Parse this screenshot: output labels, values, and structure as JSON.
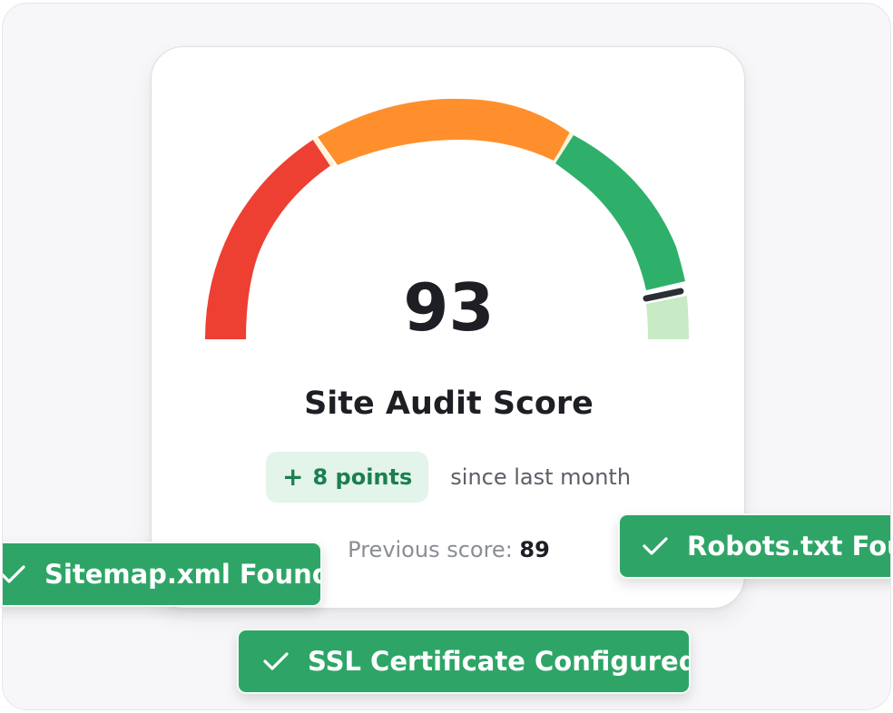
{
  "gauge": {
    "score": "93",
    "segment_colors": {
      "poor": "#ee3f33",
      "average": "#ff8f2c",
      "good": "#2fb06a",
      "remaining": "#c8eac4",
      "needle": "#2a2e35"
    }
  },
  "card": {
    "title": "Site Audit Score",
    "change_icon": "plus-icon",
    "change_label": "8 points",
    "change_suffix": "since last month",
    "previous_label": "Previous score: ",
    "previous_value": "89"
  },
  "badges": {
    "sitemap": "Sitemap.xml Found",
    "robots": "Robots.txt Found",
    "ssl": "SSL Certificate Configured",
    "icon": "check-icon"
  },
  "colors": {
    "badge_green": "#2ea567",
    "change_text": "#1b7f4f",
    "change_bg": "#e3f4ea"
  }
}
